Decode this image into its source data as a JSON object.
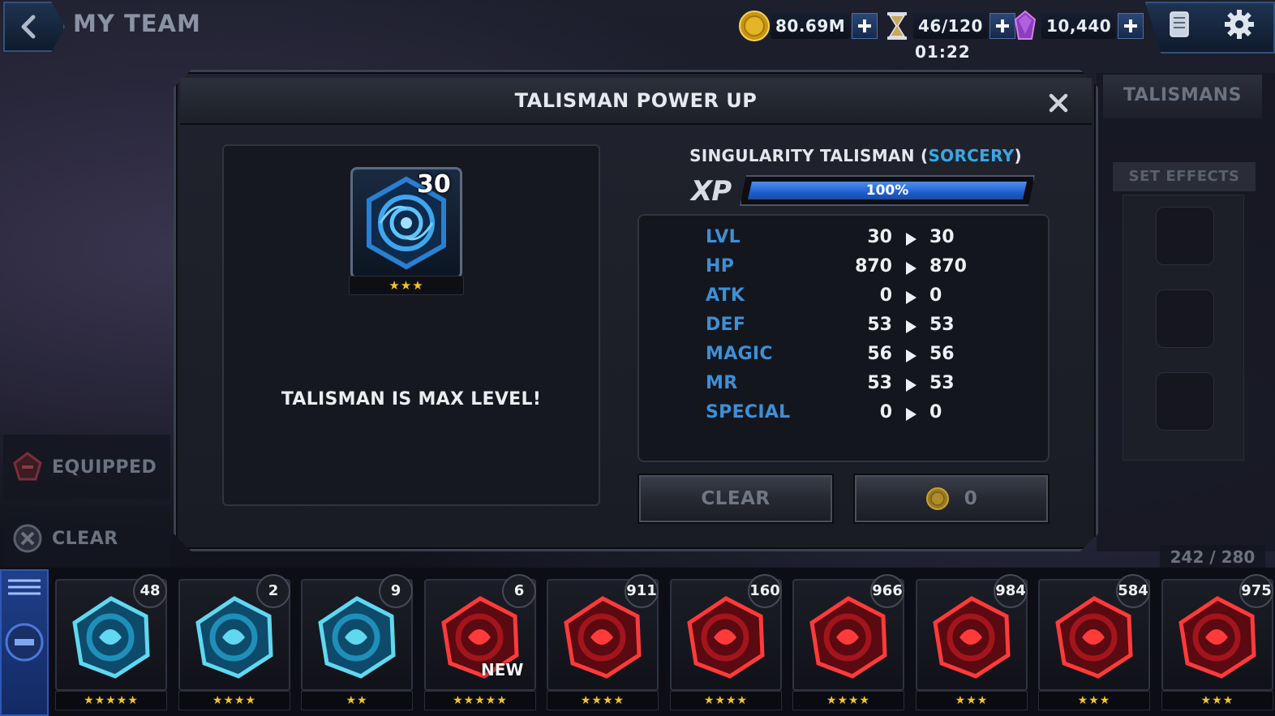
{
  "header": {
    "title": "MY TEAM",
    "gold": "80.69M",
    "energy": "46/120",
    "energy_timer": "01:22",
    "gems": "10,440"
  },
  "side": {
    "tab_talismans": "TALISMANS",
    "set_effects": "SET EFFECTS",
    "equipped": "EQUIPPED",
    "clear": "CLEAR",
    "inventory_count": "242 / 280"
  },
  "modal": {
    "title": "TALISMAN POWER UP",
    "talisman_level": "30",
    "talisman_stars": "★★★",
    "max_level_text": "TALISMAN IS MAX LEVEL!",
    "name_prefix": "SINGULARITY TALISMAN (",
    "name_class": "SORCERY",
    "name_suffix": ")",
    "xp_label": "XP",
    "xp_percent_text": "100%",
    "xp_fraction": 1.0,
    "stats": [
      {
        "name": "LVL",
        "from": "30",
        "to": "30"
      },
      {
        "name": "HP",
        "from": "870",
        "to": "870"
      },
      {
        "name": "ATK",
        "from": "0",
        "to": "0"
      },
      {
        "name": "DEF",
        "from": "53",
        "to": "53"
      },
      {
        "name": "MAGIC",
        "from": "56",
        "to": "56"
      },
      {
        "name": "MR",
        "from": "53",
        "to": "53"
      },
      {
        "name": "SPECIAL",
        "from": "0",
        "to": "0"
      }
    ],
    "clear_button": "CLEAR",
    "cost_value": "0"
  },
  "inventory": [
    {
      "count": "48",
      "stars": "★★★★★",
      "type": "blue",
      "new": ""
    },
    {
      "count": "2",
      "stars": "★★★★",
      "type": "blue",
      "new": ""
    },
    {
      "count": "9",
      "stars": "★★",
      "type": "blue",
      "new": ""
    },
    {
      "count": "6",
      "stars": "★★★★★",
      "type": "red",
      "new": "NEW"
    },
    {
      "count": "911",
      "stars": "★★★★",
      "type": "red",
      "new": ""
    },
    {
      "count": "160",
      "stars": "★★★★",
      "type": "red",
      "new": ""
    },
    {
      "count": "966",
      "stars": "★★★★",
      "type": "red",
      "new": ""
    },
    {
      "count": "984",
      "stars": "★★★",
      "type": "red",
      "new": ""
    },
    {
      "count": "584",
      "stars": "★★★",
      "type": "red",
      "new": ""
    },
    {
      "count": "975",
      "stars": "★★★",
      "type": "red",
      "new": ""
    }
  ],
  "colors": {
    "accent_blue": "#3e8fd6",
    "class_sorcery": "#36a8e8",
    "star_gold": "#f4c325",
    "xp_fill": "#1f5fd0"
  },
  "icons": [
    "back-arrow-icon",
    "gold-coin-icon",
    "hourglass-icon",
    "gem-icon",
    "plus-icon",
    "scroll-icon",
    "gear-icon",
    "close-icon",
    "talisman-icon",
    "arrow-right-icon",
    "equipped-icon",
    "clear-icon",
    "menu-icon"
  ]
}
